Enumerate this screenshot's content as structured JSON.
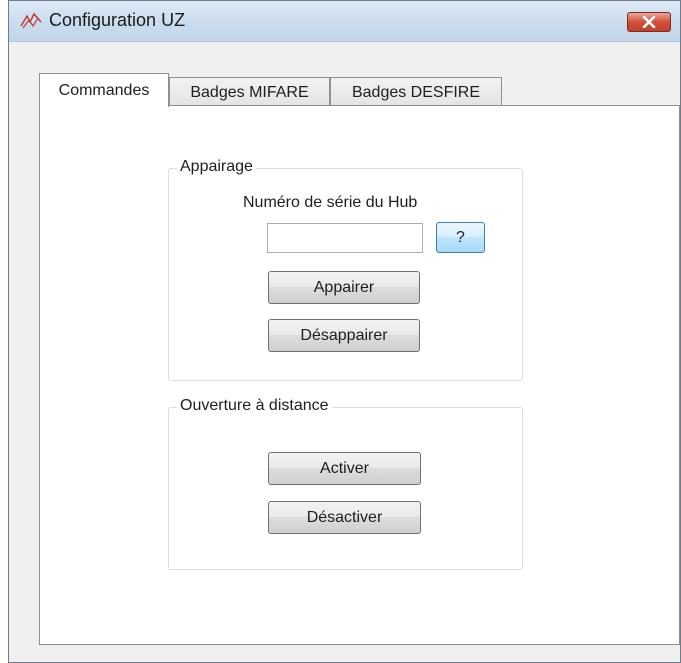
{
  "window": {
    "title": "Configuration UZ",
    "close_label": "×"
  },
  "tabs": [
    {
      "label": "Commandes",
      "active": true
    },
    {
      "label": "Badges MIFARE",
      "active": false
    },
    {
      "label": "Badges DESFIRE",
      "active": false
    }
  ],
  "pairing": {
    "group_label": "Appairage",
    "serial_label": "Numéro de série du Hub",
    "serial_value": "",
    "help_label": "?",
    "pair_label": "Appairer",
    "unpair_label": "Désappairer"
  },
  "remote": {
    "group_label": "Ouverture à distance",
    "activate_label": "Activer",
    "deactivate_label": "Désactiver"
  },
  "icons": {
    "app": "configuration-app-icon",
    "close": "close-x-icon"
  },
  "colors": {
    "titlebar": "#c9dbee",
    "close_button": "#c9452f",
    "focus_border": "#3c7fb1"
  }
}
